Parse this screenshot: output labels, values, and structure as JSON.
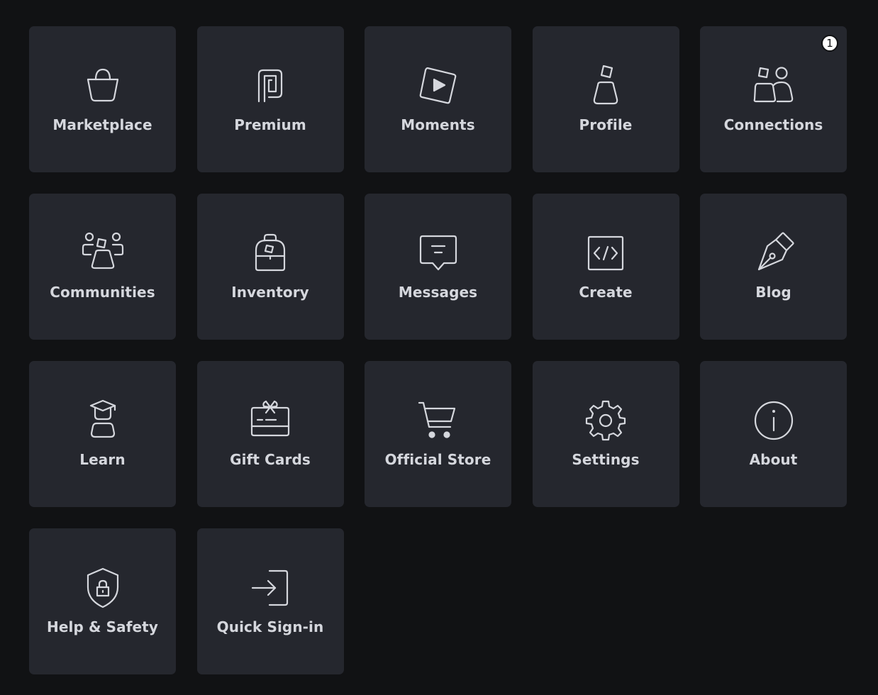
{
  "colors": {
    "background": "#111214",
    "tile": "#25272e",
    "text": "#d5d7dd",
    "badge": "#ffffff"
  },
  "tiles": [
    {
      "label": "Marketplace",
      "icon": "shopping-bag-icon"
    },
    {
      "label": "Premium",
      "icon": "premium-icon"
    },
    {
      "label": "Moments",
      "icon": "play-icon"
    },
    {
      "label": "Profile",
      "icon": "avatar-icon"
    },
    {
      "label": "Connections",
      "icon": "connections-icon",
      "badge": "1"
    },
    {
      "label": "Communities",
      "icon": "group-icon"
    },
    {
      "label": "Inventory",
      "icon": "backpack-icon"
    },
    {
      "label": "Messages",
      "icon": "message-icon"
    },
    {
      "label": "Create",
      "icon": "code-icon"
    },
    {
      "label": "Blog",
      "icon": "pen-icon"
    },
    {
      "label": "Learn",
      "icon": "graduate-icon"
    },
    {
      "label": "Gift Cards",
      "icon": "gift-card-icon"
    },
    {
      "label": "Official Store",
      "icon": "cart-icon"
    },
    {
      "label": "Settings",
      "icon": "gear-icon"
    },
    {
      "label": "About",
      "icon": "info-icon"
    },
    {
      "label": "Help & Safety",
      "icon": "shield-lock-icon"
    },
    {
      "label": "Quick Sign-in",
      "icon": "sign-in-icon"
    }
  ]
}
